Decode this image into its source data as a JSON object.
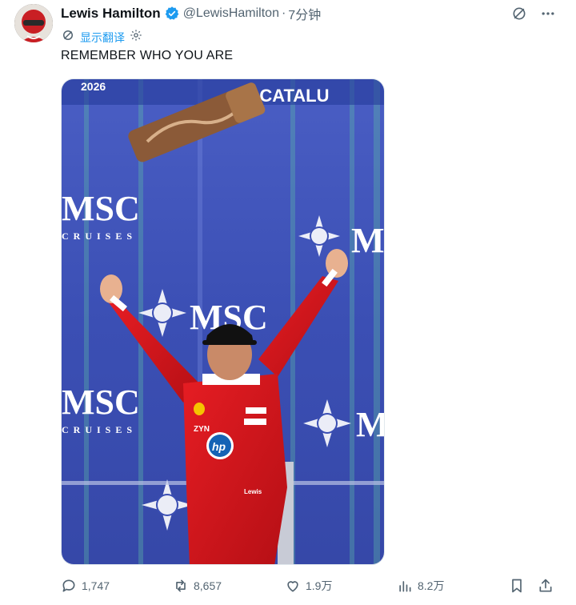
{
  "tweet": {
    "author_name": "Lewis Hamilton",
    "handle": "@LewisHamilton",
    "separator": "·",
    "time": "7分钟",
    "translate_label": "显示翻译",
    "text": "REMEMBER WHO YOU ARE"
  },
  "media": {
    "banner_year": "2026",
    "banner_text": "-CATALU",
    "brand": "MSC",
    "brand_sub": "CRUISES",
    "suit_sponsor": "ZYN",
    "suit_name": "Lewis"
  },
  "actions": {
    "replies": "1,747",
    "reposts": "8,657",
    "likes": "1.9万",
    "views": "8.2万"
  },
  "colors": {
    "accent": "#1d9bf0",
    "muted": "#536471",
    "suit_red": "#d4121a",
    "backdrop": "#3b4fb4"
  },
  "icons": {
    "verified": "verified-badge-icon",
    "grok": "grok-icon",
    "more": "more-dots-icon",
    "translate": "translate-icon",
    "settings": "gear-icon",
    "reply": "reply-icon",
    "repost": "repost-icon",
    "like": "heart-icon",
    "views": "views-icon",
    "bookmark": "bookmark-icon",
    "share": "share-icon"
  }
}
